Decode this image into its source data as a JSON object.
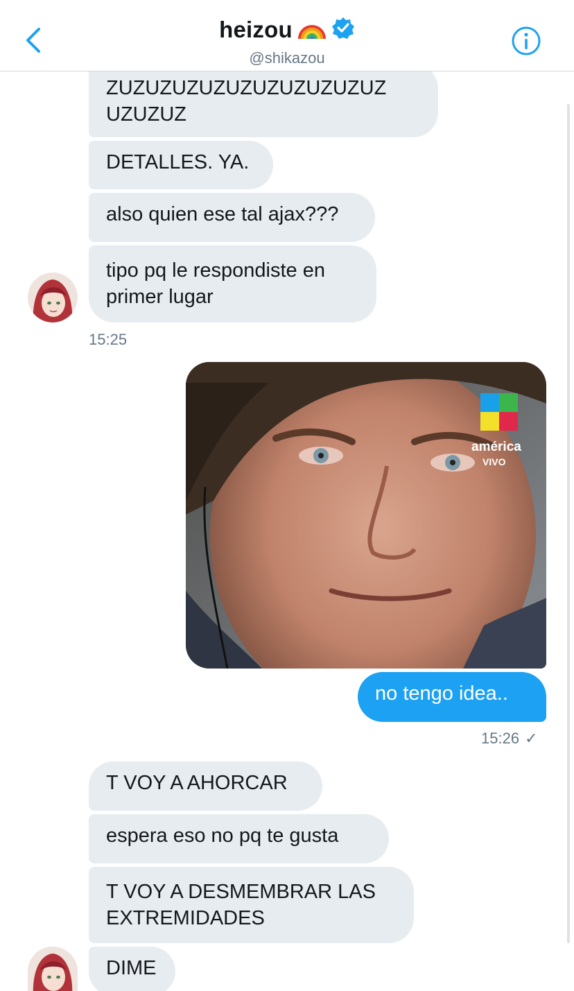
{
  "header": {
    "name": "heizou",
    "handle": "@shikazou",
    "emoji": "🌈"
  },
  "icons": {
    "back": "chevron-left-icon",
    "verified": "verified-badge-icon",
    "info": "info-icon",
    "sent": "checkmark-icon"
  },
  "colors": {
    "accent": "#1da1f2",
    "incoming_bubble": "#e6ecf0",
    "muted_text": "#657786"
  },
  "messages": {
    "m1_line1": "ZUZUZUZUZUZUZUZUZUZUZ",
    "m1_line2": "UZUZUZ",
    "m2": "DETALLES. YA.",
    "m3": "also quien ese tal ajax???",
    "m4_line1": "tipo pq le respondiste en",
    "m4_line2": "primer lugar",
    "time1": "15:25",
    "media_logo_text": "américa",
    "media_logo_sub": "VIVO",
    "m5": "no tengo idea..",
    "time2": "15:26",
    "sent_mark": "✓",
    "m6": "T VOY A AHORCAR",
    "m7": "espera eso no pq te gusta",
    "m8_line1": "T VOY A DESMEMBRAR LAS",
    "m8_line2": "EXTREMIDADES",
    "m9": "DIME"
  }
}
